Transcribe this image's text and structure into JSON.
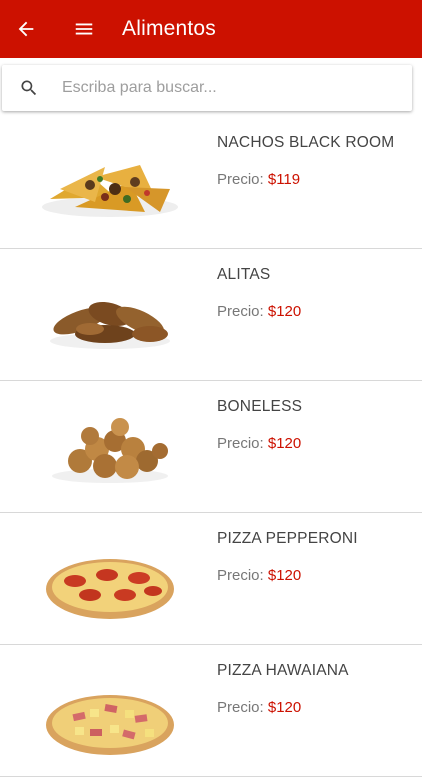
{
  "appbar": {
    "title": "Alimentos"
  },
  "search": {
    "placeholder": "Escriba para buscar..."
  },
  "colors": {
    "primary": "#cc1100",
    "price": "#cc1100"
  },
  "items": [
    {
      "name": "NACHOS BLACK ROOM",
      "price_label": "Precio:",
      "price": "$119",
      "image": "nachos"
    },
    {
      "name": "ALITAS",
      "price_label": "Precio:",
      "price": "$120",
      "image": "chicken-wings"
    },
    {
      "name": "BONELESS",
      "price_label": "Precio:",
      "price": "$120",
      "image": "boneless-chicken"
    },
    {
      "name": "PIZZA PEPPERONI",
      "price_label": "Precio:",
      "price": "$120",
      "image": "pepperoni-pizza"
    },
    {
      "name": "PIZZA HAWAIANA",
      "price_label": "Precio:",
      "price": "$120",
      "image": "hawaiian-pizza"
    }
  ]
}
